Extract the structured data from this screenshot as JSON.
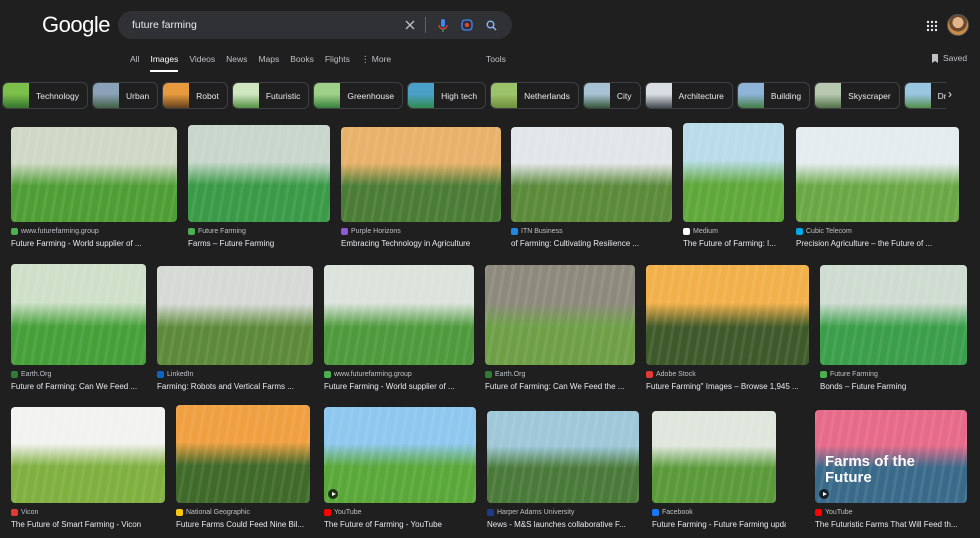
{
  "header": {
    "logo": "Google",
    "query": "future farming"
  },
  "tabs": [
    {
      "label": "All"
    },
    {
      "label": "Images"
    },
    {
      "label": "Videos"
    },
    {
      "label": "News"
    },
    {
      "label": "Maps"
    },
    {
      "label": "Books"
    },
    {
      "label": "Flights"
    },
    {
      "label": "⋮ More"
    }
  ],
  "tools_label": "Tools",
  "saved_label": "Saved",
  "chips": [
    {
      "label": "Technology",
      "c1": "#7cbf4a",
      "c2": "#2f6e2a"
    },
    {
      "label": "Urban",
      "c1": "#8aa1b8",
      "c2": "#3c5a3a"
    },
    {
      "label": "Robot",
      "c1": "#e69a3d",
      "c2": "#5b3a1d"
    },
    {
      "label": "Futuristic",
      "c1": "#cfe6c0",
      "c2": "#4d8a3a"
    },
    {
      "label": "Greenhouse",
      "c1": "#9fd08a",
      "c2": "#2f7a35"
    },
    {
      "label": "High tech",
      "c1": "#4aa0c8",
      "c2": "#2f8a46"
    },
    {
      "label": "Netherlands",
      "c1": "#9dc36a",
      "c2": "#6b8a3a"
    },
    {
      "label": "City",
      "c1": "#a8c2d4",
      "c2": "#2d4d2d"
    },
    {
      "label": "Architecture",
      "c1": "#d8dee4",
      "c2": "#3a3f45"
    },
    {
      "label": "Building",
      "c1": "#8fb4d8",
      "c2": "#3f7a3a"
    },
    {
      "label": "Skyscraper",
      "c1": "#b6c9b0",
      "c2": "#4a6a40"
    },
    {
      "label": "Drones",
      "c1": "#9ac6e0",
      "c2": "#4f8a3f"
    }
  ],
  "results": [
    {
      "source": "www.futurefarming.group",
      "title": "Future Farming - World supplier of ...",
      "fav": "#4caf50",
      "c1": "#cfd8c4",
      "c2": "#4f9e35",
      "video": false
    },
    {
      "source": "Future Farming",
      "title": "Farms – Future Farming",
      "fav": "#4caf50",
      "c1": "#c8d6cc",
      "c2": "#3a9a48",
      "video": false
    },
    {
      "source": "Purple Horizons",
      "title": "Embracing Technology in Agriculture",
      "fav": "#8e5bd6",
      "c1": "#e8b26a",
      "c2": "#4a7c36",
      "video": false
    },
    {
      "source": "ITN Business",
      "title": "of Farming: Cultivating Resilience ...",
      "fav": "#1e88e5",
      "c1": "#e3e6e8",
      "c2": "#5a8a3a",
      "video": false
    },
    {
      "source": "Medium",
      "title": "The Future of Farming: I...",
      "fav": "#ffffff",
      "c1": "#b9dce8",
      "c2": "#5fa83a",
      "video": false
    },
    {
      "source": "Cubic Telecom",
      "title": "Precision Agriculture – the Future of ...",
      "fav": "#00a8e8",
      "c1": "#e4ecef",
      "c2": "#6aa846",
      "video": false
    },
    {
      "source": "Earth.Org",
      "title": "Future of Farming: Can We Feed ...",
      "fav": "#2e7d32",
      "c1": "#cfe0c8",
      "c2": "#45a03a",
      "video": false
    },
    {
      "source": "LinkedIn",
      "title": "Farming: Robots and Vertical Farms ...",
      "fav": "#0a66c2",
      "c1": "#d7d9d6",
      "c2": "#5c8a3a",
      "video": false
    },
    {
      "source": "www.futurefarming.group",
      "title": "Future Farming - World supplier of ...",
      "fav": "#4caf50",
      "c1": "#dbe3dc",
      "c2": "#4e9a3c",
      "video": false
    },
    {
      "source": "Earth.Org",
      "title": "Future of Farming: Can We Feed the ...",
      "fav": "#2e7d32",
      "c1": "#8d8a7d",
      "c2": "#6fa048",
      "video": false
    },
    {
      "source": "Adobe Stock",
      "title": "Future Farming\" Images – Browse 1,945 ...",
      "fav": "#e53935",
      "c1": "#f2b04a",
      "c2": "#3f5a2a",
      "video": false
    },
    {
      "source": "Future Farming",
      "title": "Bonds – Future Farming",
      "fav": "#4caf50",
      "c1": "#cfdcd0",
      "c2": "#3a9e4a",
      "video": false
    },
    {
      "source": "Vicon",
      "title": "The Future of Smart Farming - Vicon",
      "fav": "#e53935",
      "c1": "#f2f2f0",
      "c2": "#7fb040",
      "video": false
    },
    {
      "source": "National Geographic",
      "title": "Future Farms Could Feed Nine Bil...",
      "fav": "#f9c80e",
      "c1": "#f0a040",
      "c2": "#3f6a2a",
      "video": false
    },
    {
      "source": "YouTube",
      "title": "The Future of Farming - YouTube",
      "fav": "#ff0000",
      "c1": "#8ec8ef",
      "c2": "#5aa83a",
      "video": true
    },
    {
      "source": "Harper Adams University",
      "title": "News - M&S launches collaborative F...",
      "fav": "#1e3a8a",
      "c1": "#9ec8d8",
      "c2": "#4a7a3a",
      "video": false
    },
    {
      "source": "Facebook",
      "title": "Future Farming - Future Farming upda...",
      "fav": "#1877f2",
      "c1": "#dfe6dc",
      "c2": "#5a9a3a",
      "video": false
    },
    {
      "source": "YouTube",
      "title": "The Futuristic Farms That Will Feed th...",
      "fav": "#ff0000",
      "c1": "#e66a8a",
      "c2": "#3a6a8a",
      "video": true,
      "overlay_text": "Farms of the Future"
    }
  ]
}
